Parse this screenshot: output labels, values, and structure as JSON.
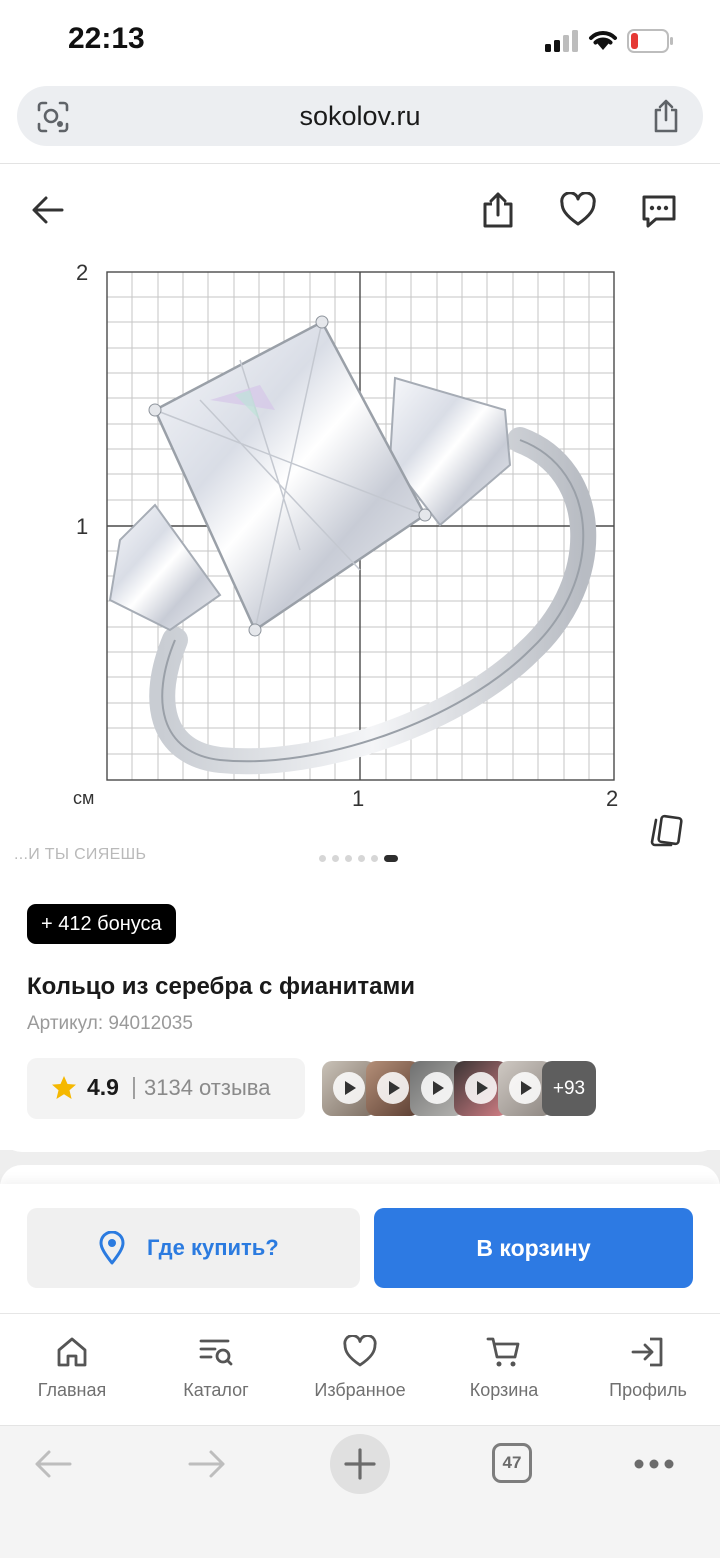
{
  "status": {
    "time": "22:13"
  },
  "browser": {
    "url": "sokolov.ru",
    "tabs_count": "47"
  },
  "product": {
    "image_grid": {
      "y_top": "2",
      "y_mid": "1",
      "unit": "см",
      "x_mid": "1",
      "x_right": "2"
    },
    "slogan": "...И ТЫ СИЯЕШЬ",
    "carousel": {
      "total": 6,
      "active": 6
    },
    "bonus": "+ 412 бонуса",
    "title": "Кольцо из серебра с фианитами",
    "article": "Артикул: 94012035",
    "rating": {
      "value": "4.9",
      "separator": "|",
      "reviews": "3134 отзыва"
    },
    "review_media": {
      "more": "+93"
    }
  },
  "actions": {
    "where_to_buy": "Где купить?",
    "add_to_cart": "В корзину"
  },
  "tabs": [
    {
      "label": "Главная",
      "icon": "home-icon"
    },
    {
      "label": "Каталог",
      "icon": "catalog-search-icon"
    },
    {
      "label": "Избранное",
      "icon": "heart-icon"
    },
    {
      "label": "Корзина",
      "icon": "cart-icon"
    },
    {
      "label": "Профиль",
      "icon": "login-icon"
    }
  ],
  "colors": {
    "accent": "#2d7ae3",
    "bonus_bg": "#000000",
    "star": "#f5b800"
  }
}
